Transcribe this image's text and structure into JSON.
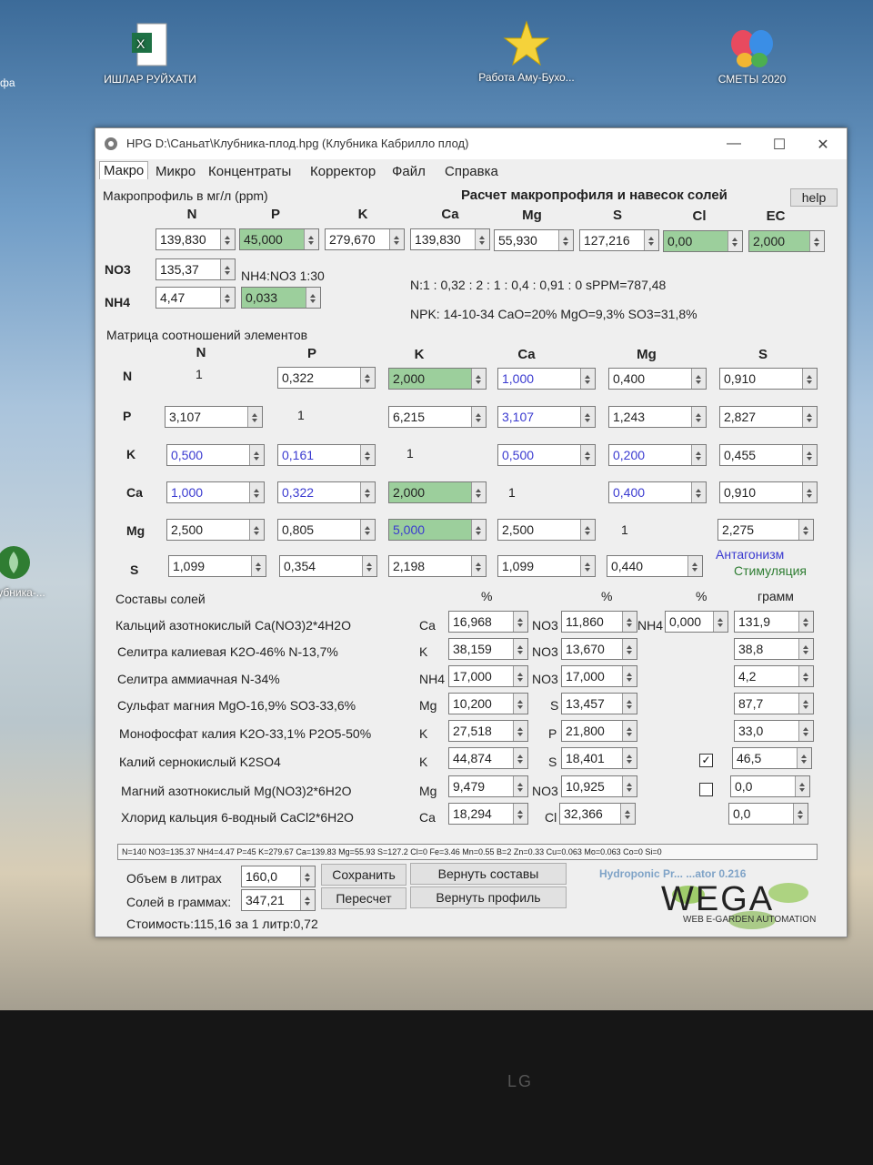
{
  "desktop": {
    "icons": [
      {
        "label": "ИШЛАР РУЙХАТИ"
      },
      {
        "label": "Работа Аму-Бухо..."
      },
      {
        "label": "СМЕТЫ 2020"
      },
      {
        "label": "...лубника-..."
      }
    ],
    "left_edge_label": "фа"
  },
  "window": {
    "title": "HPG D:\\Саньат\\Клубника-плод.hpg (Клубника Кабрилло плод)",
    "menu": [
      "Макро",
      "Микро",
      "Концентраты",
      "Корректор",
      "Файл",
      "Справка"
    ],
    "help": "help",
    "profile_title": "Макропрофиль в мг/л (ppm)",
    "calc_title": "Расчет макропрофиля и навесок солей",
    "columns": [
      "N",
      "P",
      "K",
      "Ca",
      "Mg",
      "S",
      "Cl",
      "EC"
    ],
    "profile_values": [
      "139,830",
      "45,000",
      "279,670",
      "139,830",
      "55,930",
      "127,216",
      "0,00",
      "2,000"
    ],
    "no3_label": "NO3",
    "no3_value": "135,37",
    "nh4_label": "NH4",
    "nh4_value": "4,47",
    "nh4no3_ratio_label": "NH4:NO3 1:30",
    "nh4no3_ratio_value": "0,033",
    "ratio_line": "N:1 : 0,32 : 2 : 1 : 0,4 : 0,91 : 0 sPPM=787,48",
    "npk_line": "NPK: 14-10-34 CaO=20% MgO=9,3% SO3=31,8%",
    "matrix_title": "Матрица соотношений элементов",
    "matrix_cols": [
      "N",
      "P",
      "K",
      "Ca",
      "Mg",
      "S"
    ],
    "matrix_rows": [
      {
        "label": "N",
        "cells": [
          "1",
          "0,322",
          "2,000",
          "1,000",
          "0,400",
          "0,910"
        ]
      },
      {
        "label": "P",
        "cells": [
          "3,107",
          "1",
          "6,215",
          "3,107",
          "1,243",
          "2,827"
        ]
      },
      {
        "label": "K",
        "cells": [
          "0,500",
          "0,161",
          "1",
          "0,500",
          "0,200",
          "0,455"
        ]
      },
      {
        "label": "Ca",
        "cells": [
          "1,000",
          "0,322",
          "2,000",
          "1",
          "0,400",
          "0,910"
        ]
      },
      {
        "label": "Mg",
        "cells": [
          "2,500",
          "0,805",
          "5,000",
          "2,500",
          "1",
          "2,275"
        ]
      },
      {
        "label": "S",
        "cells": [
          "1,099",
          "0,354",
          "2,198",
          "1,099",
          "0,440"
        ]
      }
    ],
    "antagonism": "Антагонизм",
    "stimulation": "Стимуляция",
    "salts_title": "Составы солей",
    "pct": "%",
    "gram": "грамм",
    "salts": [
      {
        "name": "Кальций азотнокислый Ca(NO3)2*4H2O",
        "e1": "Ca",
        "v1": "16,968",
        "e2": "NO3",
        "v2": "11,860",
        "e3": "NH4",
        "v3": "0,000",
        "g": "131,9"
      },
      {
        "name": "Селитра калиевая K2O-46% N-13,7%",
        "e1": "K",
        "v1": "38,159",
        "e2": "NO3",
        "v2": "13,670",
        "g": "38,8"
      },
      {
        "name": "Селитра аммиачная N-34%",
        "e1": "NH4",
        "v1": "17,000",
        "e2": "NO3",
        "v2": "17,000",
        "g": "4,2"
      },
      {
        "name": "Сульфат магния MgO-16,9% SO3-33,6%",
        "e1": "Mg",
        "v1": "10,200",
        "e2": "S",
        "v2": "13,457",
        "g": "87,7"
      },
      {
        "name": "Монофосфат калия K2O-33,1% P2O5-50%",
        "e1": "K",
        "v1": "27,518",
        "e2": "P",
        "v2": "21,800",
        "g": "33,0"
      },
      {
        "name": "Калий сернокислый K2SO4",
        "e1": "K",
        "v1": "44,874",
        "e2": "S",
        "v2": "18,401",
        "checked": true,
        "g": "46,5"
      },
      {
        "name": "Магний азотнокислый Mg(NO3)2*6H2O",
        "e1": "Mg",
        "v1": "9,479",
        "e2": "NO3",
        "v2": "10,925",
        "checked": false,
        "g": "0,0"
      },
      {
        "name": "Хлорид кальция 6-водный CaCl2*6H2O",
        "e1": "Ca",
        "v1": "18,294",
        "e2": "Cl",
        "v2": "32,366",
        "g": "0,0"
      }
    ],
    "status_line": "N=140 NO3=135.37 NH4=4.47 P=45 K=279.67 Ca=139.83 Mg=55.93 S=127.2 Cl=0 Fe=3.46 Mn=0.55 B=2 Zn=0.33 Cu=0.063 Mo=0.063 Co=0 Si=0",
    "volume_label": "Объем в литрах",
    "volume_value": "160,0",
    "salts_gram_label": "Солей в граммах:",
    "salts_gram_value": "347,21",
    "save_btn": "Сохранить",
    "restore_compositions_btn": "Вернуть составы",
    "recalc_btn": "Пересчет",
    "restore_profile_btn": "Вернуть профиль",
    "cost_line": "Стоимость:115,16 за 1 литр:0,72",
    "brand_caption": "Hydroponic Pr... ...ator 0.216",
    "brand_logo": "WEGA",
    "brand_sub": "WEB E-GARDEN AUTOMATION"
  },
  "monitor_brand": "LG"
}
